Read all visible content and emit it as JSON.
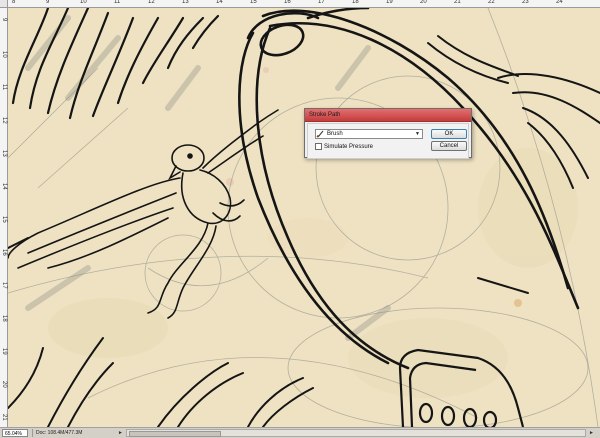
{
  "ruler": {
    "top_labels": [
      "8",
      "9",
      "10",
      "11",
      "12",
      "13",
      "14",
      "15",
      "16",
      "17",
      "18",
      "19",
      "20",
      "21",
      "22",
      "23",
      "24"
    ],
    "left_labels": [
      "9",
      "10",
      "11",
      "12",
      "13",
      "14",
      "15",
      "16",
      "17",
      "18",
      "19",
      "20",
      "21"
    ]
  },
  "dialog": {
    "title": "Stroke Path",
    "tool_value": "Brush",
    "checkbox_label": "Simulate Pressure",
    "ok_label": "OK",
    "cancel_label": "Cancel"
  },
  "status": {
    "zoom": "65.04%",
    "doc_info": "Doc: 108.4M/477.3M",
    "arrow_left": "◄",
    "arrow_right": "►"
  },
  "colors": {
    "canvas": "#eee2c2",
    "title_bar": "#d04848"
  }
}
